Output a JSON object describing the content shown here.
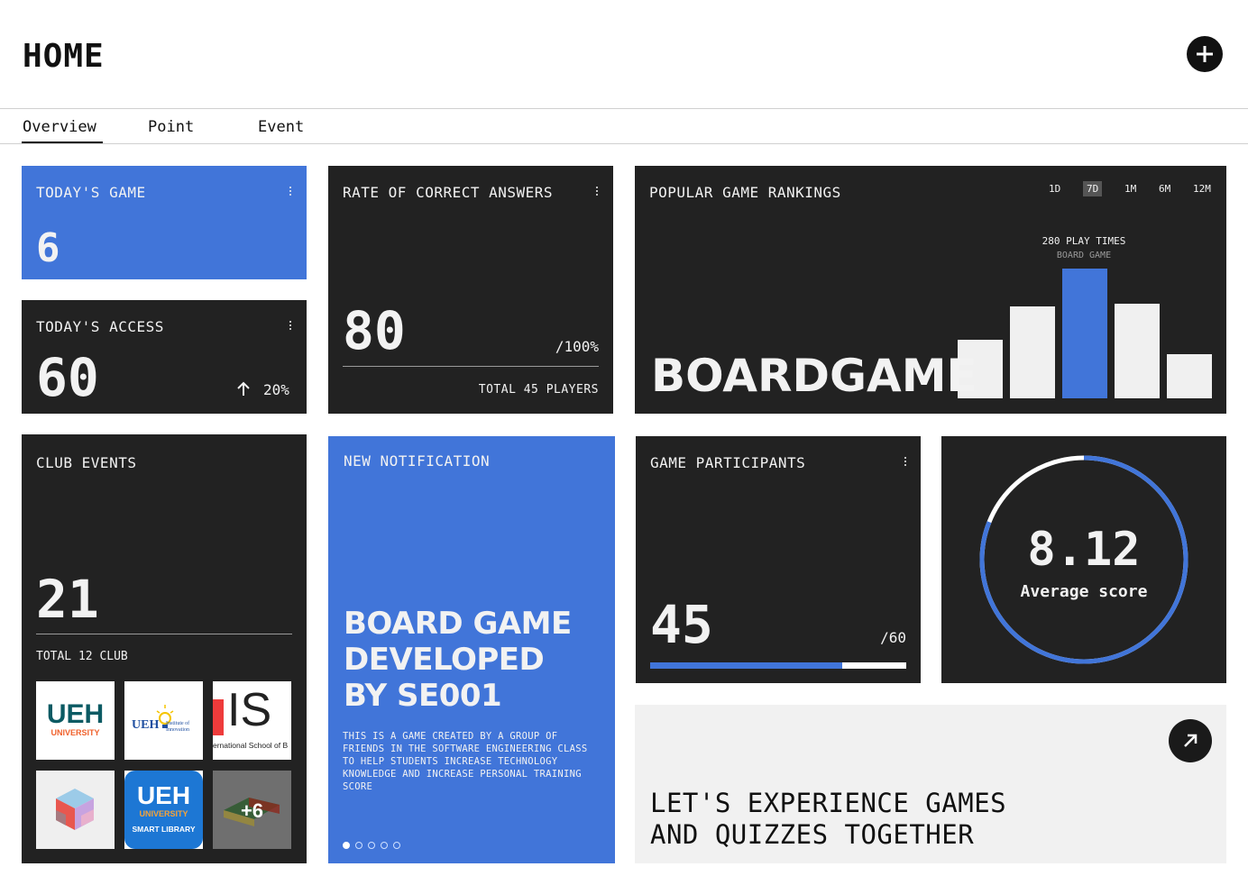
{
  "header": {
    "title": "HOME"
  },
  "tabs": [
    {
      "label": "Overview",
      "active": true
    },
    {
      "label": "Point"
    },
    {
      "label": "Event"
    }
  ],
  "todays_game": {
    "title": "TODAY'S GAME",
    "value": "6"
  },
  "todays_access": {
    "title": "TODAY'S ACCESS",
    "value": "60",
    "change": "20%"
  },
  "correct_rate": {
    "title": "RATE OF CORRECT ANSWERS",
    "value": "80",
    "suffix": "/100%",
    "footer": "TOTAL 45 PLAYERS"
  },
  "rankings": {
    "title": "POPULAR GAME RANKINGS",
    "ranges": [
      "1D",
      "7D",
      "1M",
      "6M",
      "12M"
    ],
    "active_range": "7D",
    "highlight_value": "280 PLAY TIMES",
    "highlight_label": "BOARD GAME",
    "headline": "BOARDGAME"
  },
  "chart_data": {
    "type": "bar",
    "values": [
      0.45,
      0.71,
      1.0,
      0.73,
      0.34
    ],
    "highlight_index": 2,
    "highlight_value": 280
  },
  "club_events": {
    "title": "CLUB EVENTS",
    "value": "21",
    "footer": "TOTAL 12 CLUB",
    "logos": [
      {
        "name": "UEH University logo",
        "lines": [
          "UEH",
          "UNIVERSITY"
        ]
      },
      {
        "name": "UEH Institute of Innovation logo",
        "lines": [
          "UEH",
          "Institute of",
          "Innovation"
        ]
      },
      {
        "name": "International School logo",
        "lines": [
          "IS",
          "ernational School of B"
        ]
      },
      {
        "name": "Cube logo"
      },
      {
        "name": "UEH Smart Library logo",
        "lines": [
          "UEH",
          "UNIVERSITY",
          "SMART LIBRARY"
        ]
      },
      {
        "name": "More clubs",
        "more": "+6"
      }
    ]
  },
  "notification": {
    "title": "NEW NOTIFICATION",
    "headline_lines": [
      "BOARD GAME",
      "DEVELOPED",
      "BY SE001"
    ],
    "body_lines": [
      "THIS IS A GAME CREATED BY A GROUP OF",
      "FRIENDS IN THE SOFTWARE ENGINEERING CLASS",
      "TO HELP STUDENTS INCREASE TECHNOLOGY",
      "KNOWLEDGE AND INCREASE PERSONAL TRAINING",
      "SCORE"
    ],
    "slides": 5,
    "active_slide": 0
  },
  "participants": {
    "title": "GAME PARTICIPANTS",
    "value": "45",
    "total": "/60",
    "progress": 0.75
  },
  "average": {
    "value": "8.12",
    "label": "Average score",
    "ring_fill": 0.81
  },
  "cta": {
    "lines": [
      "LET'S EXPERIENCE GAMES",
      "AND QUIZZES TOGETHER"
    ]
  },
  "colors": {
    "accent": "#4175d9",
    "dark": "#222222",
    "light": "#f1f1f1"
  }
}
